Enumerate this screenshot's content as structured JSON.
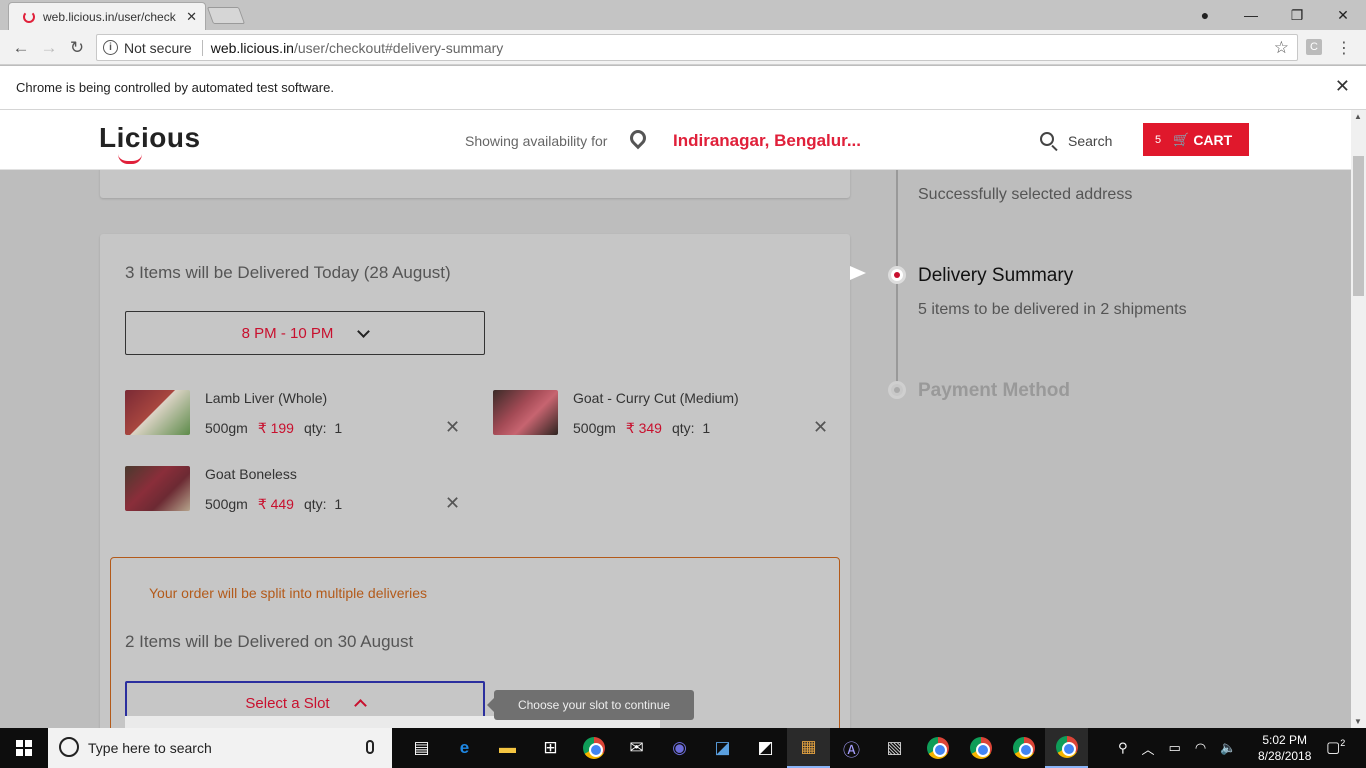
{
  "browser": {
    "tab_title": "web.licious.in/user/check",
    "url_security": "Not secure",
    "url_host": "web.licious.in",
    "url_path": "/user/checkout#delivery-summary",
    "infobar_text": "Chrome is being controlled by automated test software."
  },
  "header": {
    "logo": "Licious",
    "availability_label": "Showing availability for",
    "location": "Indiranagar, Bengalur...",
    "search_label": "Search",
    "cart_count": "5",
    "cart_label": "CART"
  },
  "shipment1": {
    "title": "3 Items will be Delivered Today (28 August)",
    "slot": "8 PM - 10 PM",
    "items": [
      {
        "name": "Lamb Liver (Whole)",
        "weight": "500gm",
        "price": "₹ 199",
        "qty_label": "qty:",
        "qty": "1"
      },
      {
        "name": "Goat - Curry Cut (Medium)",
        "weight": "500gm",
        "price": "₹ 349",
        "qty_label": "qty:",
        "qty": "1"
      },
      {
        "name": "Goat Boneless",
        "weight": "500gm",
        "price": "₹ 449",
        "qty_label": "qty:",
        "qty": "1"
      }
    ]
  },
  "shipment2": {
    "split_message": "Your order will be split into multiple deliveries",
    "title": "2 Items will be Delivered on 30 August",
    "slot_placeholder": "Select a Slot",
    "tooltip": "Choose your slot to continue"
  },
  "steps": {
    "address_sub": "Successfully selected address",
    "delivery_title": "Delivery Summary",
    "delivery_sub": "5 items to be delivered in 2 shipments",
    "payment_title": "Payment Method"
  },
  "taskbar": {
    "search_placeholder": "Type here to search",
    "time": "5:02 PM",
    "date": "8/28/2018",
    "notification_count": "2"
  },
  "colors": {
    "brand_red": "#e0182c",
    "price_red": "#c8102e",
    "split_orange": "#b35a1a",
    "slot_focus_blue": "#2b2f9e"
  }
}
